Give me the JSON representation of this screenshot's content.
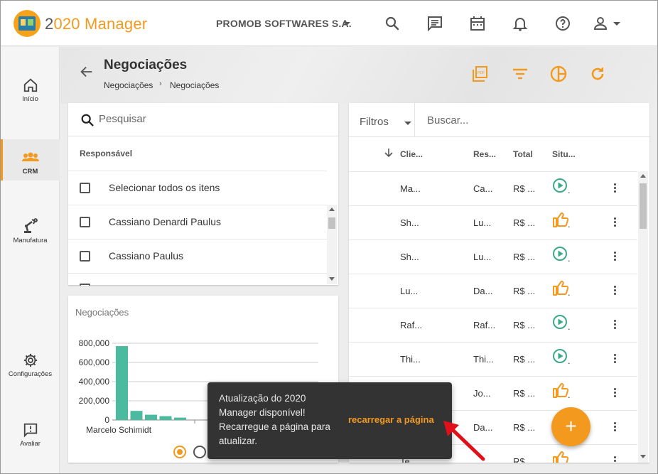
{
  "app": {
    "brand_a": "2",
    "brand_b": "020",
    "brand_c": " Manager",
    "company": "PROMOB SOFTWARES S.A."
  },
  "icons": [
    "search-icon",
    "chat-icon",
    "calendar-icon",
    "bell-icon",
    "help-icon",
    "account-icon"
  ],
  "sidebar": {
    "items": [
      {
        "label": "Início",
        "icon": "home-icon"
      },
      {
        "label": "CRM",
        "icon": "people-icon",
        "active": true
      },
      {
        "label": "Manufatura",
        "icon": "robot-arm-icon"
      },
      {
        "label": "Configurações",
        "icon": "gear-icon"
      },
      {
        "label": "Avaliar",
        "icon": "feedback-icon"
      }
    ]
  },
  "header": {
    "title": "Negociações",
    "breadcrumb": [
      "Negociações",
      "Negociações"
    ],
    "actions": [
      "pdf-icon",
      "filter-icon",
      "pie-chart-icon",
      "refresh-icon"
    ]
  },
  "filter_panel": {
    "search_placeholder": "Pesquisar",
    "column_header": "Responsável",
    "items": [
      "Selecionar todos os itens",
      "Cassiano Denardi Paulus",
      "Cassiano Paulus"
    ]
  },
  "chart_card": {
    "title": "Negociações",
    "chart_data": {
      "type": "bar",
      "categories": [
        "Marcelo Schimidt",
        "",
        "",
        "",
        ""
      ],
      "values": [
        770000,
        95000,
        55000,
        40000,
        25000
      ],
      "ylim": [
        0,
        800000
      ],
      "ytick_labels": [
        "0",
        "200,000",
        "400,000",
        "600,000",
        "800,000"
      ],
      "yticks": [
        0,
        200000,
        400000,
        600000,
        800000
      ],
      "xtick_label": "Marcelo Schimidt",
      "bar_color": "#4bbba0",
      "grid": true
    }
  },
  "table": {
    "filter_label": "Filtros",
    "search_placeholder": "Buscar...",
    "columns": [
      "Clie...",
      "Res...",
      "Total",
      "Situ..."
    ],
    "rows": [
      {
        "cliente": "Ma...",
        "responsavel": "Ca...",
        "total": "R$ ...",
        "situacao": "play-circle-icon",
        "sit_text": "."
      },
      {
        "cliente": "Sh...",
        "responsavel": "Lu...",
        "total": "R$ ...",
        "situacao": "thumb-up-icon",
        "sit_text": "."
      },
      {
        "cliente": "Sh...",
        "responsavel": "Lu...",
        "total": "R$ ...",
        "situacao": "play-circle-icon",
        "sit_text": "."
      },
      {
        "cliente": "Lu...",
        "responsavel": "Da...",
        "total": "R$ ...",
        "situacao": "thumb-up-icon",
        "sit_text": "."
      },
      {
        "cliente": "Raf...",
        "responsavel": "Raf...",
        "total": "R$ ...",
        "situacao": "play-circle-icon",
        "sit_text": "."
      },
      {
        "cliente": "Thi...",
        "responsavel": "Thi...",
        "total": "R$ ...",
        "situacao": "play-circle-icon",
        "sit_text": "."
      },
      {
        "cliente": "",
        "responsavel": "Jo...",
        "total": "R$ ...",
        "situacao": "thumb-up-icon",
        "sit_text": "."
      },
      {
        "cliente": "",
        "responsavel": "Da...",
        "total": "R$ ...",
        "situacao": "",
        "sit_text": ""
      },
      {
        "cliente": "Te...",
        "responsavel": "",
        "total": "R$",
        "situacao": "thumb-up-icon",
        "sit_text": ""
      }
    ]
  },
  "toast": {
    "message": "Atualização do 2020 Manager disponível! Recarregue a página para atualizar.",
    "action": "recarregar a página"
  },
  "fab": {
    "label": "+"
  },
  "colors": {
    "accent": "#f39a1e",
    "teal": "#4bbba0",
    "toast_bg": "#333333",
    "annotation_red": "#e0101a"
  }
}
